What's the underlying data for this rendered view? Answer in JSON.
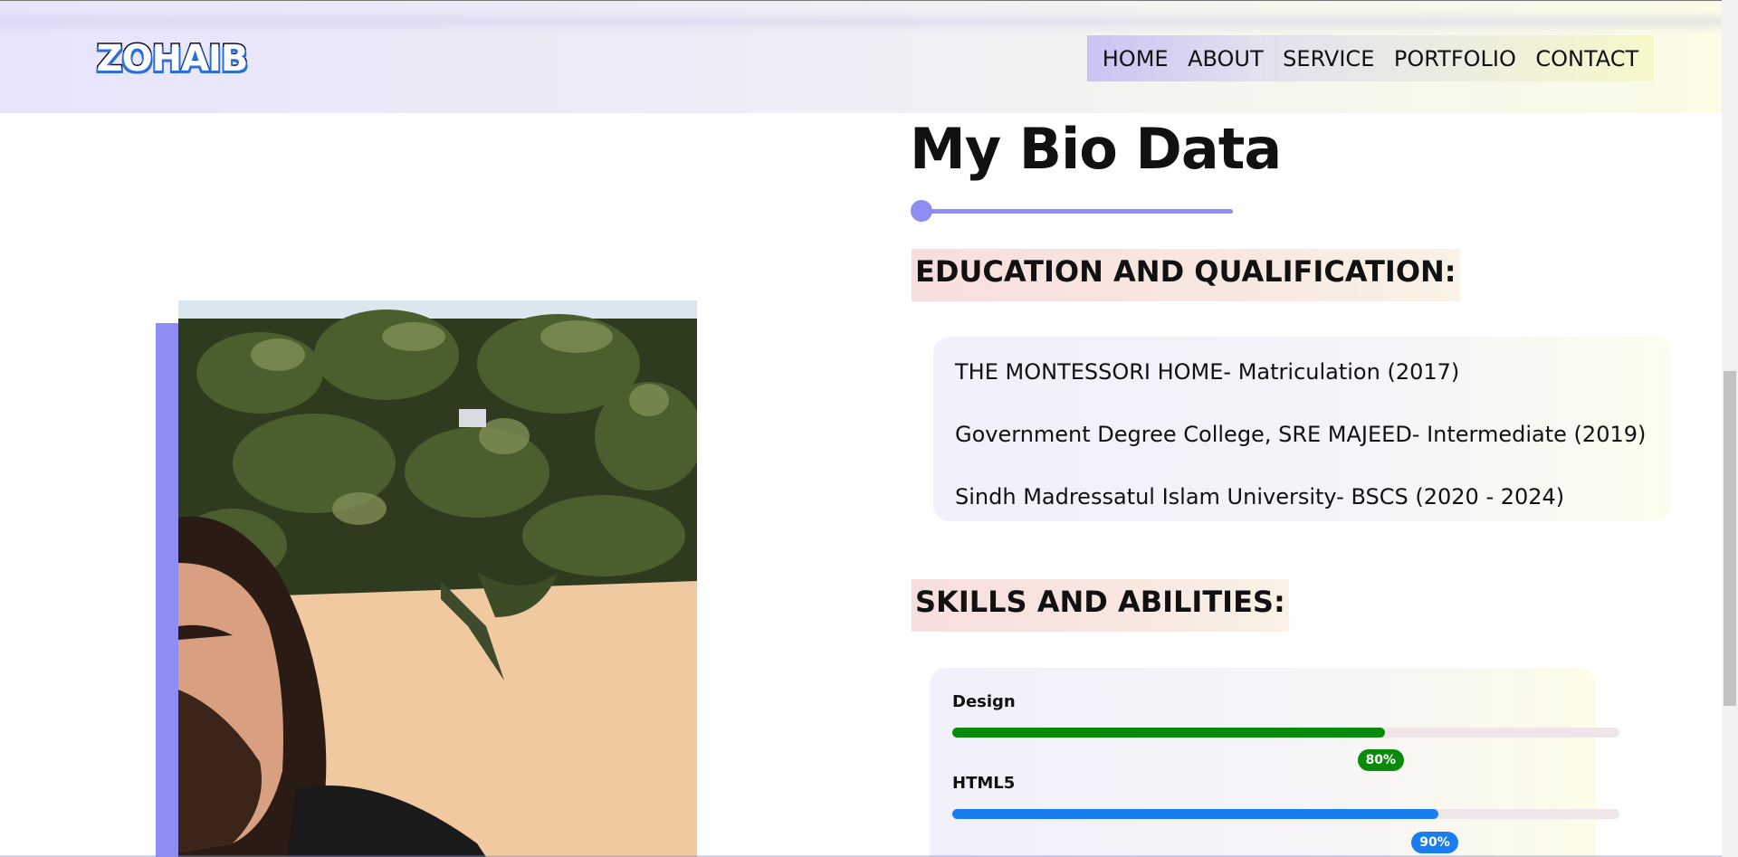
{
  "header": {
    "logo_text": "ZOHAIB",
    "nav": [
      {
        "label": "HOME"
      },
      {
        "label": "ABOUT"
      },
      {
        "label": "SERVICE"
      },
      {
        "label": "PORTFOLIO"
      },
      {
        "label": "CONTACT"
      }
    ]
  },
  "bio": {
    "title": "My Bio Data",
    "education_heading": "EDUCATION AND QUALIFICATION:",
    "education": [
      "THE MONTESSORI HOME- Matriculation (2017)",
      "Government Degree College, SRE MAJEED- Intermediate (2019)",
      "Sindh Madressatul Islam University- BSCS (2020 - 2024)"
    ],
    "skills_heading": "SKILLS AND ABILITIES:",
    "skills": [
      {
        "name": "Design",
        "percent_label": "80%",
        "percent": 80,
        "color": "#0a8a0a"
      },
      {
        "name": "HTML5",
        "percent_label": "90%",
        "percent": 90,
        "color": "#1a7ef0"
      }
    ]
  },
  "colors": {
    "accent": "#8d8df4",
    "nav_gradient_start": "#c9c3f2",
    "nav_gradient_end": "#f6f8c9"
  },
  "icons": {
    "photo": "portrait-photo"
  }
}
